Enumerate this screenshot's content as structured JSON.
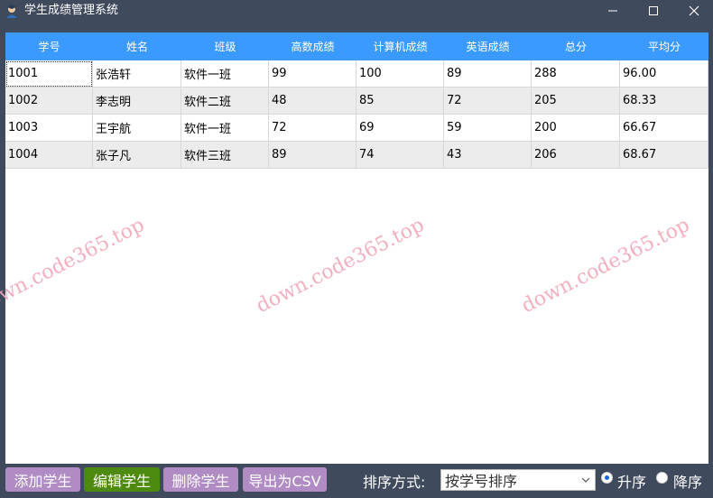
{
  "window": {
    "title": "学生成绩管理系统",
    "icons": {
      "app": "student-avatar-icon",
      "minimize": "minimize-icon",
      "maximize": "maximize-icon",
      "close": "close-icon"
    }
  },
  "table": {
    "header_color": "#3b9aff",
    "columns": [
      "学号",
      "姓名",
      "班级",
      "高数成绩",
      "计算机成绩",
      "英语成绩",
      "总分",
      "平均分"
    ],
    "rows": [
      [
        "1001",
        "张浩轩",
        "软件一班",
        "99",
        "100",
        "89",
        "288",
        "96.00"
      ],
      [
        "1002",
        "李志明",
        "软件二班",
        "48",
        "85",
        "72",
        "205",
        "68.33"
      ],
      [
        "1003",
        "王宇航",
        "软件一班",
        "72",
        "69",
        "59",
        "200",
        "66.67"
      ],
      [
        "1004",
        "张子凡",
        "软件三班",
        "89",
        "74",
        "43",
        "206",
        "68.67"
      ]
    ]
  },
  "watermark": {
    "text": "down.code365.top"
  },
  "toolbar": {
    "add_label": "添加学生",
    "edit_label": "编辑学生",
    "delete_label": "删除学生",
    "export_label": "导出为CSV",
    "sort_label": "排序方式:",
    "sort_value": "按学号排序",
    "asc_label": "升序",
    "desc_label": "降序",
    "asc_checked": true
  }
}
